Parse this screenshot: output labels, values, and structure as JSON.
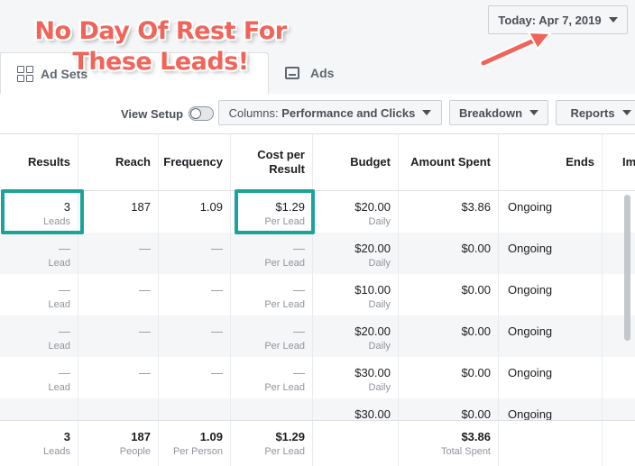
{
  "date_button": {
    "label": "Today: Apr 7, 2019"
  },
  "tabs": [
    {
      "label": "Ad Sets"
    },
    {
      "label": "Ads"
    }
  ],
  "toolbar": {
    "view_setup": "View Setup",
    "columns_prefix": "Columns: ",
    "columns_value": "Performance and Clicks",
    "breakdown": "Breakdown",
    "reports": "Reports"
  },
  "columns": [
    "Results",
    "Reach",
    "Frequency",
    "Cost per Result",
    "Budget",
    "Amount Spent",
    "Ends",
    "Im"
  ],
  "rows": [
    {
      "results": "3",
      "results_sub": "Leads",
      "reach": "187",
      "frequency": "1.09",
      "cost": "$1.29",
      "cost_sub": "Per Lead",
      "budget": "$20.00",
      "budget_sub": "Daily",
      "spent": "$3.86",
      "ends": "Ongoing"
    },
    {
      "results": "—",
      "results_sub": "Lead",
      "reach": "—",
      "frequency": "—",
      "cost": "—",
      "cost_sub": "Per Lead",
      "budget": "$20.00",
      "budget_sub": "Daily",
      "spent": "$0.00",
      "ends": "Ongoing"
    },
    {
      "results": "—",
      "results_sub": "Lead",
      "reach": "—",
      "frequency": "—",
      "cost": "—",
      "cost_sub": "Per Lead",
      "budget": "$10.00",
      "budget_sub": "Daily",
      "spent": "$0.00",
      "ends": "Ongoing"
    },
    {
      "results": "—",
      "results_sub": "Lead",
      "reach": "—",
      "frequency": "—",
      "cost": "—",
      "cost_sub": "Per Lead",
      "budget": "$20.00",
      "budget_sub": "Daily",
      "spent": "$0.00",
      "ends": "Ongoing"
    },
    {
      "results": "—",
      "results_sub": "Lead",
      "reach": "—",
      "frequency": "—",
      "cost": "—",
      "cost_sub": "Per Lead",
      "budget": "$30.00",
      "budget_sub": "Daily",
      "spent": "$0.00",
      "ends": "Ongoing"
    },
    {
      "results": "",
      "results_sub": "",
      "reach": "",
      "frequency": "",
      "cost": "",
      "cost_sub": "",
      "budget": "$30.00",
      "budget_sub": "",
      "spent": "$0.00",
      "ends": "Ongoing"
    }
  ],
  "totals": {
    "results": "3",
    "results_sub": "Leads",
    "reach": "187",
    "reach_sub": "People",
    "frequency": "1.09",
    "frequency_sub": "Per Person",
    "cost": "$1.29",
    "cost_sub": "Per Lead",
    "spent": "$3.86",
    "spent_sub": "Total Spent"
  },
  "annotation": {
    "line1": "No Day Of Rest For",
    "line2": "These Leads!"
  },
  "colors": {
    "highlight": "#1aa39a",
    "annotation": "#f0645a"
  }
}
